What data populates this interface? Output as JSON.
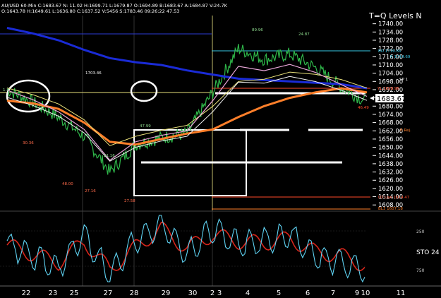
{
  "header": {
    "line1": "AU/USD 60-Min C:1683.67 N: 11.02 H:1699.71 L:1679.87 O:1694.89 B:1683.67 A:1684.87 V:24.7K",
    "line2": "O:1643.78 H:1649.61 L:1636.80 C:1637.52 V:5456 S:1783.46 09:26:22 47.53",
    "title": "T=Q Levels N"
  },
  "price_axis": {
    "ticks": [
      "1740.00",
      "1734.00",
      "1728.00",
      "1722.00",
      "1716.00",
      "1710.00",
      "1704.00",
      "1698.00",
      "1692.00",
      "1686.00",
      "1680.00",
      "1674.00",
      "1668.00",
      "1662.00",
      "1656.00",
      "1650.00",
      "1644.00",
      "1638.00",
      "1632.00",
      "1626.00",
      "1620.00",
      "1614.00",
      "1608.00"
    ],
    "last_price": "1683.67"
  },
  "osc_axis": {
    "label": "STO 24",
    "ticks": [
      "250",
      "750"
    ]
  },
  "time_axis": {
    "labels": [
      "22",
      "23",
      "25",
      "27",
      "28",
      "29",
      "30",
      "2",
      "3",
      "4",
      "5",
      "6",
      "7",
      "9",
      "10",
      "11"
    ]
  },
  "annotations": {
    "left_levels": [
      "1.3",
      "30.36",
      "48.00",
      "27.16",
      "27.58",
      "47.99",
      "21.16",
      "1703.46",
      "1683.75"
    ],
    "top_labels": [
      "89.96",
      "24.87"
    ],
    "right_labels": [
      "BO 1716.66",
      "R 1714.69",
      "SP 1",
      "YL 1698.96",
      "B Rej.",
      "LO Low 1614.47",
      "BL3 1607.18",
      "46.49"
    ]
  },
  "colors": {
    "background": "#000000",
    "price": "#2fb84a",
    "ma_orange": "#ff7f2a",
    "ma_blue": "#1a2bd6",
    "ma_yellow": "#e8e07a",
    "ma_pink": "#e9a6d9",
    "ma_white": "#f2f2f2",
    "osc_red": "#d8261c",
    "osc_cyan": "#5fd3f3",
    "axis_text": "#ffffff"
  },
  "chart_data": {
    "type": "line",
    "title": "AU/USD 60-Min",
    "xlabel": "",
    "ylabel": "",
    "ylim": [
      1604,
      1746
    ],
    "x": [
      "22",
      "23",
      "25",
      "27",
      "28",
      "29",
      "30",
      "2",
      "3",
      "4",
      "5",
      "6",
      "7",
      "9",
      "10"
    ],
    "series": [
      {
        "name": "price",
        "values": [
          1692,
          1683,
          1672,
          1658,
          1632,
          1652,
          1657,
          1660,
          1690,
          1722,
          1714,
          1718,
          1708,
          1694,
          1683
        ]
      },
      {
        "name": "ma_orange",
        "values": [
          1684,
          1682,
          1678,
          1668,
          1654,
          1652,
          1656,
          1660,
          1663,
          1672,
          1680,
          1686,
          1690,
          1693,
          1690
        ]
      },
      {
        "name": "ma_blue",
        "values": [
          1737,
          1733,
          1728,
          1721,
          1715,
          1712,
          1710,
          1706,
          1703,
          1700,
          1699,
          1698,
          1697,
          1696,
          1693
        ]
      }
    ],
    "oscillator": {
      "ylim": [
        0,
        1000
      ],
      "ticks": [
        250,
        750
      ],
      "series": [
        {
          "name": "red",
          "values": [
            550,
            420,
            300,
            600,
            200,
            520,
            780,
            500,
            700,
            600,
            580,
            640,
            450,
            400,
            250
          ]
        },
        {
          "name": "cyan",
          "values": [
            580,
            380,
            220,
            700,
            120,
            620,
            860,
            420,
            780,
            560,
            600,
            700,
            380,
            320,
            160
          ]
        }
      ]
    }
  }
}
